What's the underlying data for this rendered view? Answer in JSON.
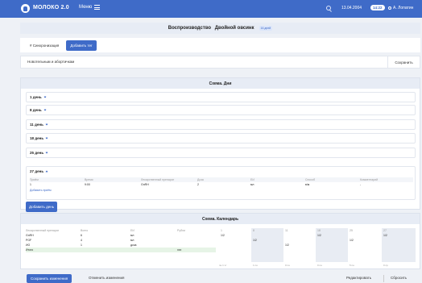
{
  "header": {
    "app_title": "МОЛОКО 2.0",
    "menu_label": "Меню",
    "date": "13.04.2004",
    "date_badge": "14:22",
    "user_name": "А. Лопатин",
    "icons": [
      "logo-icon",
      "hamburger-icon",
      "search-icon",
      "user-icon"
    ],
    "color": "#3f6bc8"
  },
  "page": {
    "title": "Воспроизводство",
    "subtitle": "Двойной овсинк",
    "badge": "16 дней"
  },
  "tags": {
    "chip_label": "# Синхронизация",
    "add_tag_label": "Добавить тег"
  },
  "comment": {
    "value": "Новотельным и абортичкам",
    "save_label": "Сохранить"
  },
  "schema_days": {
    "title": "Схема. Дни",
    "days": [
      "1 день",
      "8 день",
      "11 день",
      "18 день",
      "25 день"
    ],
    "open_day": "27 день",
    "table": {
      "columns": [
        "Приём",
        "Время",
        "Лекарственный препарат",
        "Доза",
        "ЕИ",
        "Способ",
        "Комментарий"
      ],
      "rows": [
        [
          "1",
          "9:00",
          "GnRH",
          "2",
          "мл",
          "в/м",
          "-"
        ]
      ],
      "add_dose_label": "Добавить приём"
    },
    "add_day_label": "Добавить день"
  },
  "schema_calendar": {
    "title": "Схема. Календарь",
    "left_columns": [
      "Лекарственный препарат",
      "Всего",
      "ЕИ",
      "Рубли"
    ],
    "left_rows": [
      [
        "GnRH",
        "6",
        "мл",
        ""
      ],
      [
        "PGF",
        "4",
        "мл",
        ""
      ],
      [
        "ИО",
        "1",
        "доза",
        ""
      ],
      [
        "Итого",
        "",
        "",
        "xxx"
      ]
    ],
    "days": [
      "1",
      "8",
      "11",
      "18",
      "25",
      "27"
    ],
    "cells": [
      [
        "1/2",
        "",
        "",
        "1/2",
        "",
        "1/2"
      ],
      [
        "",
        "1/2",
        "",
        "",
        "1/2",
        ""
      ],
      [
        "",
        "",
        "1/2",
        "",
        "",
        ""
      ]
    ],
    "footer": [
      "пн 1 чт",
      "1 пн",
      "0 пн",
      "0 пн",
      "5 пн",
      "0 ср"
    ]
  },
  "bottom": {
    "save_changes": "Сохранить изменения",
    "cancel_changes": "Отменить изменения",
    "edit": "Редактировать",
    "reset": "Сбросить"
  }
}
